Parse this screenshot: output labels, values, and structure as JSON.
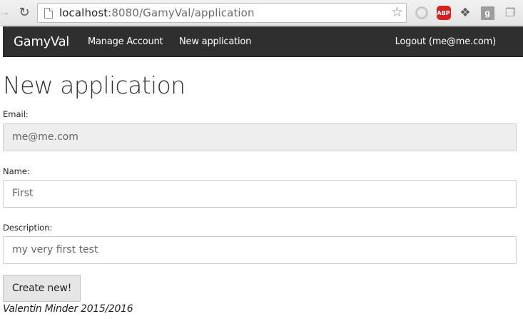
{
  "browser": {
    "url_host": "localhost",
    "url_rest": ":8080/GamyVal/application",
    "icons": {
      "back": "arrow-left-icon",
      "reload": "reload-icon",
      "page": "page-icon",
      "star": "star-icon",
      "ext1": "circle-extension-icon",
      "ext2": "adblock-plus-icon",
      "ext3": "puzzle-extension-icon",
      "ext4": "google-plus-icon",
      "ext5": "copy-extension-icon"
    },
    "abp_text": "ABP",
    "gplus_text": "g"
  },
  "navbar": {
    "brand": "GamyVal",
    "links": {
      "manage": "Manage Account",
      "new_app": "New application",
      "logout": "Logout (me@me.com)"
    },
    "background": "#2f2f2f"
  },
  "main": {
    "title": "New application",
    "email": {
      "label": "Email:",
      "value": "me@me.com"
    },
    "name": {
      "label": "Name:",
      "value": "First"
    },
    "description": {
      "label": "Description:",
      "value": "my very first test"
    },
    "submit_label": "Create new!"
  },
  "footer": {
    "text": "Valentin Minder 2015/2016"
  }
}
